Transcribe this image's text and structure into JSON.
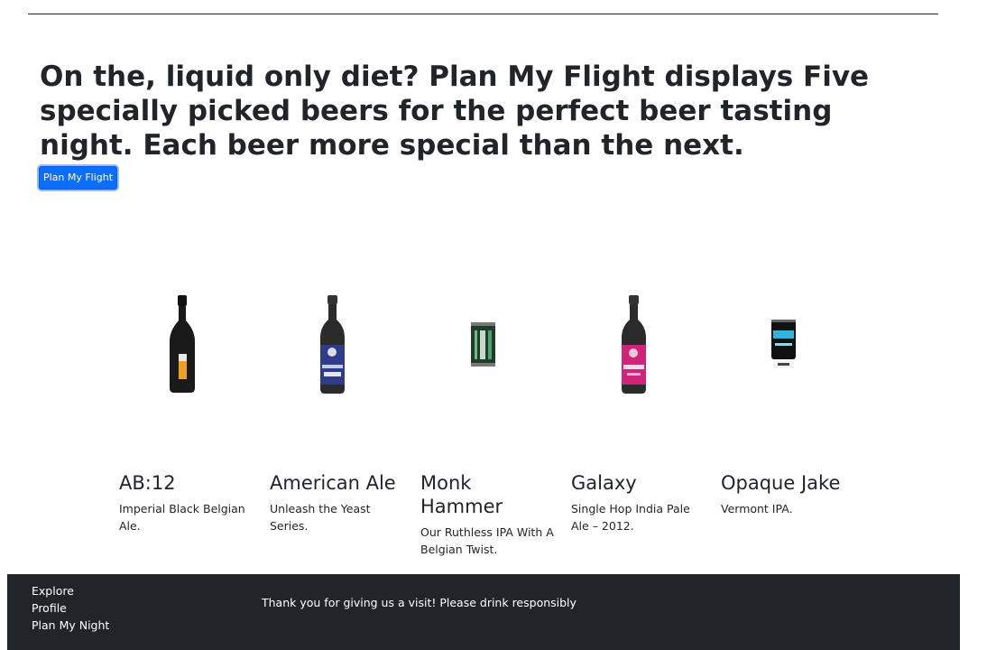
{
  "header": {
    "headline": "On the, liquid only diet? Plan My Flight displays Five specially picked beers for the perfect beer tasting night. Each beer more special than the next.",
    "cta_label": "Plan My Flight"
  },
  "beers": [
    {
      "name": "AB:12",
      "description": "Imperial Black Belgian Ale.",
      "image": "black-bottle"
    },
    {
      "name": "American Ale",
      "description": "Unleash the Yeast Series.",
      "image": "blue-label-bottle"
    },
    {
      "name": "Monk Hammer",
      "description": "Our Ruthless IPA With A Belgian Twist.",
      "image": "green-can"
    },
    {
      "name": "Galaxy",
      "description": "Single Hop India Pale Ale – 2012.",
      "image": "pink-label-bottle"
    },
    {
      "name": "Opaque Jake",
      "description": "Vermont IPA.",
      "image": "blue-can"
    }
  ],
  "footer": {
    "links": [
      "Explore",
      "Profile",
      "Plan My Night"
    ],
    "message": "Thank you for giving us a visit! Please drink responsibly"
  },
  "colors": {
    "primary": "#0d6efd",
    "footer_bg": "#212529",
    "text": "#212529"
  }
}
